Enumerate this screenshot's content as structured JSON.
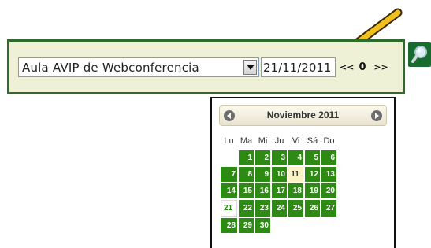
{
  "filter": {
    "room_select_value": "Aula AVIP de Webconferencia",
    "date_value": "21/11/2011",
    "nav": {
      "prev": "<<",
      "current": "0",
      "next": ">>"
    }
  },
  "icons": {
    "search": "magnifier-icon",
    "dropdown": "chevron-down-icon",
    "annotation": "yellow-arrow-icon"
  },
  "calendar": {
    "month_title": "Noviembre 2011",
    "prev_label": "prev-month",
    "next_label": "next-month",
    "weekdays": [
      "Lu",
      "Ma",
      "Mi",
      "Ju",
      "Vi",
      "Sá",
      "Do"
    ],
    "weeks": [
      [
        "",
        "1",
        "2",
        "3",
        "4",
        "5",
        "6"
      ],
      [
        "7",
        "8",
        "9",
        "10",
        "11",
        "12",
        "13"
      ],
      [
        "14",
        "15",
        "16",
        "17",
        "18",
        "19",
        "20"
      ],
      [
        "21",
        "22",
        "23",
        "24",
        "25",
        "26",
        "27"
      ],
      [
        "28",
        "29",
        "30",
        "",
        "",
        "",
        ""
      ]
    ],
    "highlighted_day": "11",
    "selected_day": "21"
  },
  "colors": {
    "panel_bg": "#eef1d6",
    "panel_border": "#2f6b2b",
    "day_cell": "#2d8a13",
    "arrow": "#f2c01c"
  }
}
